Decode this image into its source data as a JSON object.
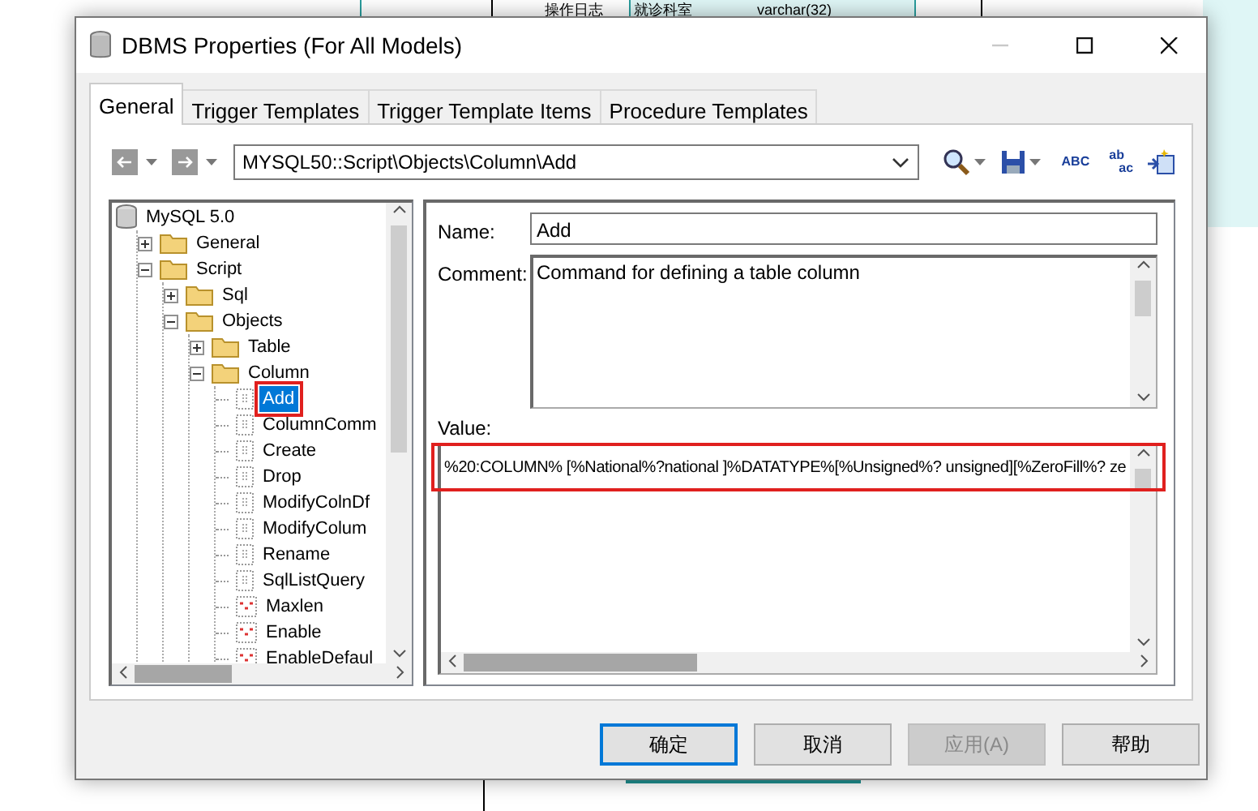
{
  "background": {
    "entity_title": "操作日志",
    "entity_row": {
      "name": "就诊科室",
      "type": "varchar(32)"
    }
  },
  "window": {
    "title": "DBMS Properties (For All Models)",
    "controls": [
      {
        "kind": "minimize",
        "disabled": true
      },
      {
        "kind": "maximize",
        "disabled": false
      },
      {
        "kind": "close",
        "disabled": false
      }
    ]
  },
  "tabs": [
    {
      "label": "General",
      "selected": true
    },
    {
      "label": "Trigger Templates",
      "selected": false
    },
    {
      "label": "Trigger Template Items",
      "selected": false
    },
    {
      "label": "Procedure Templates",
      "selected": false
    }
  ],
  "toolbar": {
    "nav": [
      {
        "kind": "back",
        "disabled": true
      },
      {
        "kind": "forward",
        "disabled": true
      }
    ],
    "path": "MYSQL50::Script\\Objects\\Column\\Add",
    "tools": [
      {
        "kind": "search",
        "dropdown": true
      },
      {
        "kind": "save",
        "dropdown": true
      },
      {
        "kind": "spell",
        "glyphs": [
          "ABC"
        ]
      },
      {
        "kind": "replace",
        "glyphs": [
          "ab",
          "ac"
        ]
      },
      {
        "kind": "import"
      }
    ]
  },
  "tree": [
    {
      "label": "MySQL 5.0",
      "kind": "database",
      "children": [
        {
          "label": "General",
          "kind": "folder",
          "expanded": false
        },
        {
          "label": "Script",
          "kind": "folder",
          "expanded": true,
          "children": [
            {
              "label": "Sql",
              "kind": "folder",
              "expanded": false
            },
            {
              "label": "Objects",
              "kind": "folder",
              "expanded": true,
              "children": [
                {
                  "label": "Table",
                  "kind": "folder",
                  "expanded": false
                },
                {
                  "label": "Column",
                  "kind": "folder",
                  "expanded": true,
                  "children": [
                    {
                      "label": "Add",
                      "kind": "script",
                      "selected": true,
                      "highlighted": true
                    },
                    {
                      "label": "ColumnComm",
                      "kind": "script",
                      "selected": false,
                      "highlighted": false
                    },
                    {
                      "label": "Create",
                      "kind": "script",
                      "selected": false,
                      "highlighted": false
                    },
                    {
                      "label": "Drop",
                      "kind": "script",
                      "selected": false,
                      "highlighted": false
                    },
                    {
                      "label": "ModifyColnDf",
                      "kind": "script",
                      "selected": false,
                      "highlighted": false
                    },
                    {
                      "label": "ModifyColum",
                      "kind": "script",
                      "selected": false,
                      "highlighted": false
                    },
                    {
                      "label": "Rename",
                      "kind": "script",
                      "selected": false,
                      "highlighted": false
                    },
                    {
                      "label": "SqlListQuery",
                      "kind": "script",
                      "selected": false,
                      "highlighted": false
                    },
                    {
                      "label": "Maxlen",
                      "kind": "value",
                      "selected": false,
                      "highlighted": false
                    },
                    {
                      "label": "Enable",
                      "kind": "value",
                      "selected": false,
                      "highlighted": false
                    },
                    {
                      "label": "EnableDefaul",
                      "kind": "value",
                      "selected": false,
                      "highlighted": false
                    }
                  ]
                }
              ]
            }
          ]
        }
      ]
    }
  ],
  "form": {
    "name": {
      "label": "Name:",
      "value": "Add"
    },
    "comment": {
      "label": "Comment:",
      "value": "Command for defining a table column"
    },
    "value": {
      "label": "Value:",
      "value": "%20:COLUMN% [%National%?national ]%DATATYPE%[%Unsigned%? unsigned][%ZeroFill%? ze",
      "highlighted": true
    }
  },
  "buttons": [
    {
      "label": "确定",
      "default": true,
      "disabled": false
    },
    {
      "label": "取消",
      "default": false,
      "disabled": false
    },
    {
      "label": "应用(A)",
      "default": false,
      "disabled": true
    },
    {
      "label": "帮助",
      "default": false,
      "disabled": false
    }
  ]
}
